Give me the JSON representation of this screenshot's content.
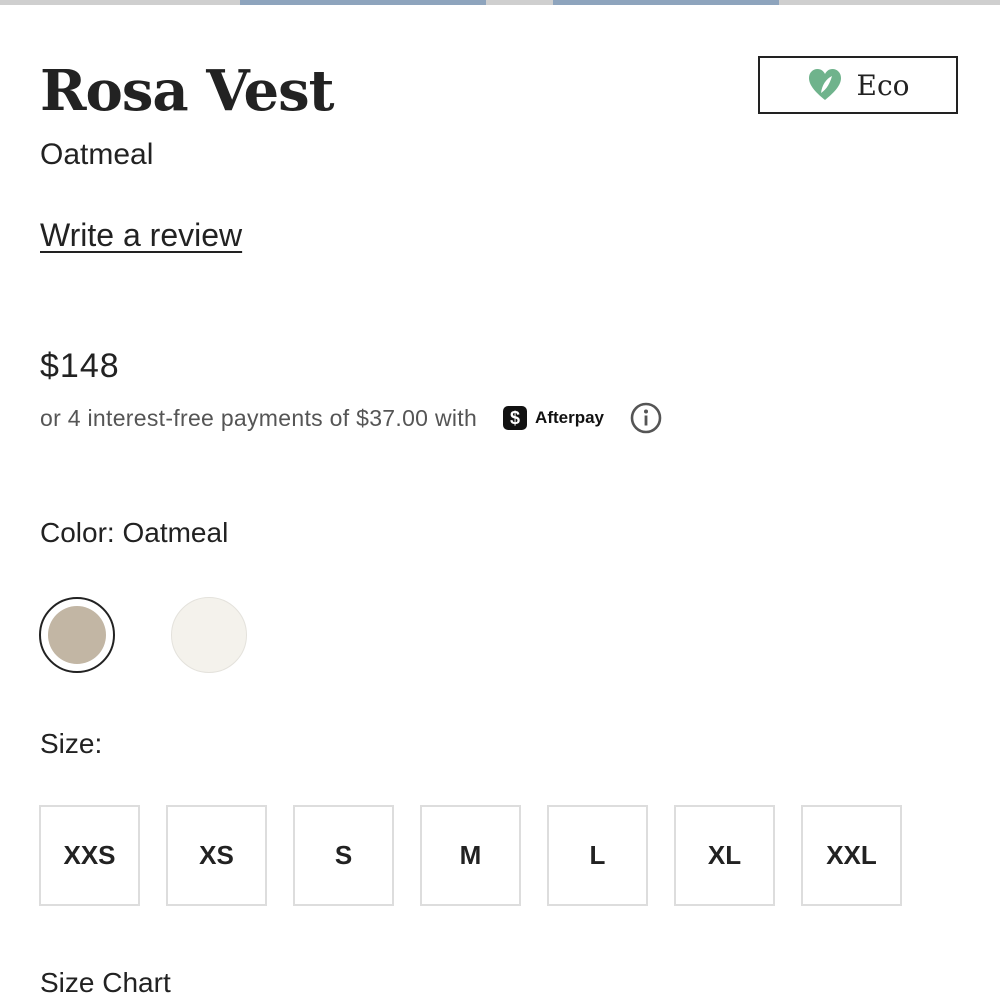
{
  "product": {
    "title": "Rosa Vest",
    "color_name": "Oatmeal",
    "badge": {
      "label": "Eco",
      "icon": "heart-leaf-icon",
      "icon_color": "#6fb38c"
    }
  },
  "reviews": {
    "link_label": "Write a review"
  },
  "pricing": {
    "price": "$148",
    "installment_text": "or 4 interest-free payments of $37.00 with",
    "provider_name": "Afterpay",
    "provider_icon": "afterpay-dollar-icon",
    "info_icon": "info-icon"
  },
  "color_selector": {
    "label": "Color: Oatmeal",
    "swatches": [
      {
        "name": "Oatmeal",
        "hex": "#c2b6a4",
        "selected": true
      },
      {
        "name": "Ivory",
        "hex": "#f4f2ec",
        "selected": false
      }
    ]
  },
  "size_selector": {
    "label": "Size:",
    "options": [
      "XXS",
      "XS",
      "S",
      "M",
      "L",
      "XL",
      "XXL"
    ],
    "size_chart_label": "Size Chart"
  }
}
